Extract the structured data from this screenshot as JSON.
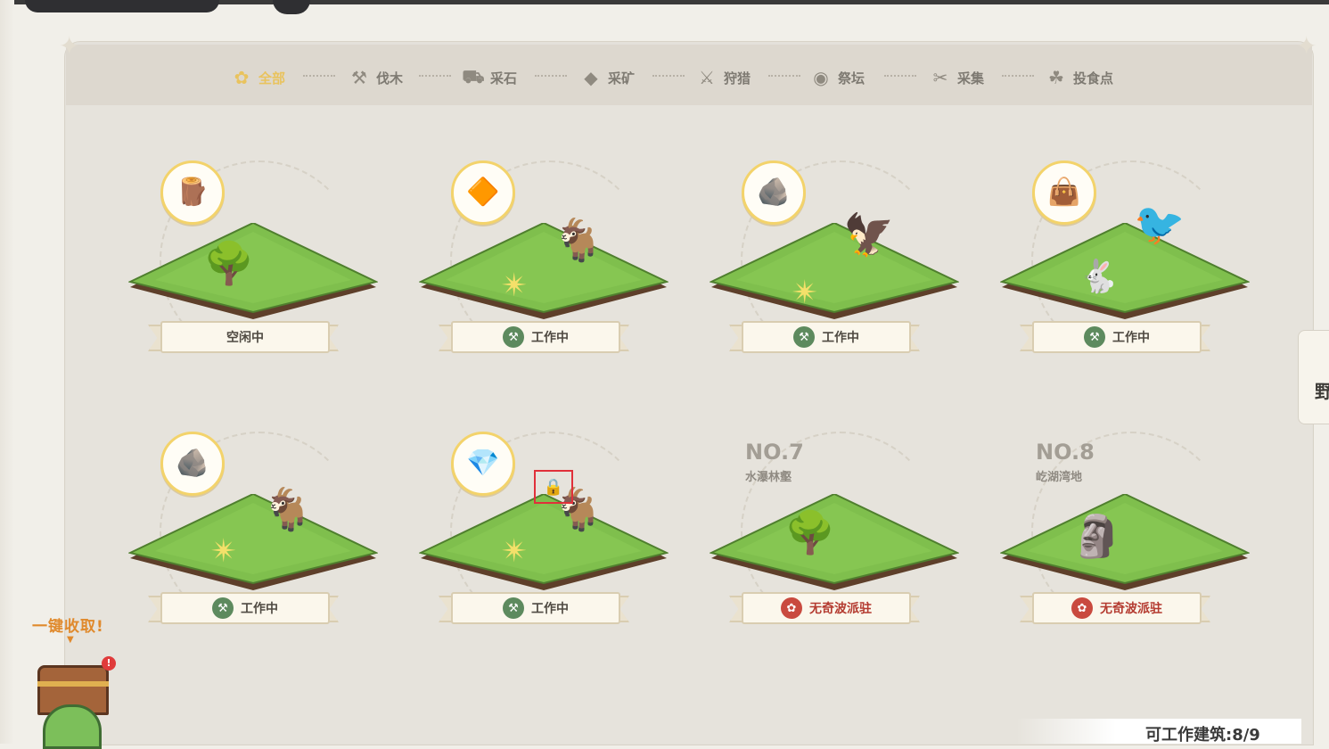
{
  "tabs": [
    {
      "label": "全部",
      "icon": "clover-icon",
      "active": true
    },
    {
      "label": "伐木",
      "icon": "axe-icon"
    },
    {
      "label": "采石",
      "icon": "cart-icon"
    },
    {
      "label": "采矿",
      "icon": "crystal-icon"
    },
    {
      "label": "狩猎",
      "icon": "claw-icon"
    },
    {
      "label": "祭坛",
      "icon": "eye-icon"
    },
    {
      "label": "采集",
      "icon": "pick-icon"
    },
    {
      "label": "投食点",
      "icon": "feed-icon"
    }
  ],
  "cards": [
    {
      "resource_icon": "wood-icon",
      "status": "空闲中",
      "status_kind": "idle"
    },
    {
      "resource_icon": "pink-ore-icon",
      "status": "工作中",
      "status_kind": "working"
    },
    {
      "resource_icon": "stone-icon",
      "status": "工作中",
      "status_kind": "working"
    },
    {
      "resource_icon": "leather-icon",
      "status": "工作中",
      "status_kind": "working"
    },
    {
      "resource_icon": "stone-icon",
      "status": "工作中",
      "status_kind": "working"
    },
    {
      "resource_icon": "blue-crystal-icon",
      "status": "工作中",
      "status_kind": "working"
    },
    {
      "number": "NO.7",
      "location": "水瀑林壑",
      "status": "无奇波派驻",
      "status_kind": "empty"
    },
    {
      "number": "NO.8",
      "location": "屹湖湾地",
      "status": "无奇波派驻",
      "status_kind": "empty"
    }
  ],
  "side_tab_label": "野",
  "collect_all_label": "一键收取!",
  "chest_alert": "!",
  "footer": {
    "workable_label": "可工作建筑:8/9"
  },
  "colors": {
    "active_tab": "#e9c35e",
    "working": "#5d8a5e",
    "empty": "#c94a3f",
    "grass": "#7fbf4d"
  }
}
